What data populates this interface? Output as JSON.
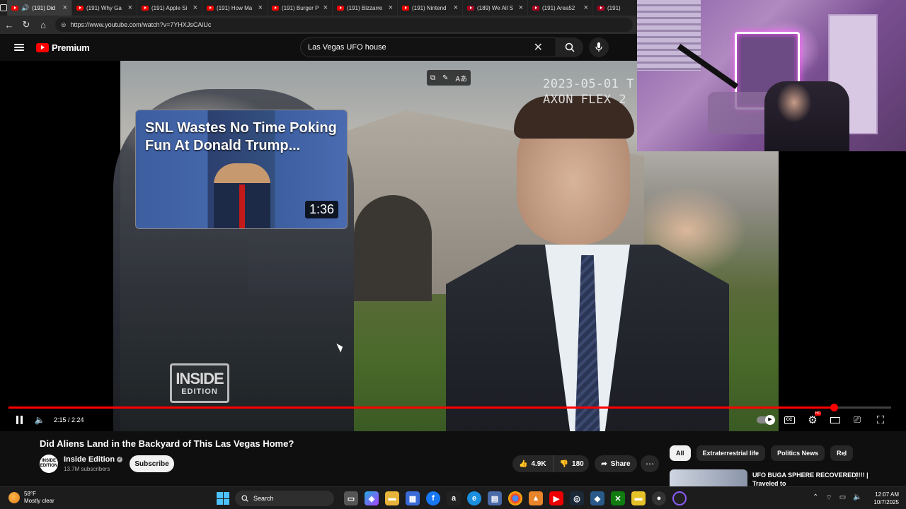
{
  "browser": {
    "tabs": [
      {
        "title": "(191) Did",
        "active": true,
        "audio": true
      },
      {
        "title": "(191) Why Ga"
      },
      {
        "title": "(191) Apple Si"
      },
      {
        "title": "(191) How Ma"
      },
      {
        "title": "(191) Burger P"
      },
      {
        "title": "(191) Bizzarre"
      },
      {
        "title": "(191) Nintend"
      },
      {
        "title": "(189) We All S"
      },
      {
        "title": "(191) Area52"
      },
      {
        "title": "(191)"
      }
    ],
    "url": "https://www.youtube.com/watch?v=7YHXJsCAlUc"
  },
  "youtube": {
    "logo_text": "Premium",
    "search_query": "Las Vegas UFO house"
  },
  "player": {
    "timestamp_overlay": [
      "2023-05-01 T",
      "AXON FLEX 2"
    ],
    "watermark": [
      "INSIDE",
      "EDITION"
    ],
    "end_card": {
      "title": "SNL Wastes No Time Poking Fun At Donald Trump...",
      "duration": "1:36"
    },
    "time_display": "2:15 / 2:24",
    "progress_fraction": 0.935,
    "accent_color": "#ff0000"
  },
  "video_info": {
    "title": "Did Aliens Land in the Backyard of This Las Vegas Home?",
    "channel_name": "Inside Edition",
    "channel_avatar_text": "INSIDE EDITION",
    "subscribers": "13.7M subscribers",
    "subscribe_label": "Subscribe",
    "likes": "4.9K",
    "dislikes": "180",
    "share_label": "Share",
    "more_label": "⋯"
  },
  "sidebar": {
    "chips": [
      "All",
      "Extraterrestrial life",
      "Politics News",
      "Rel"
    ],
    "rec_title": "UFO BUGA SPHERE RECOVERED!!!! | Traveled to"
  },
  "taskbar": {
    "temp": "58°F",
    "condition": "Mostly clear",
    "search_label": "Search",
    "time": "12:07 AM",
    "date": "10/7/2025"
  }
}
